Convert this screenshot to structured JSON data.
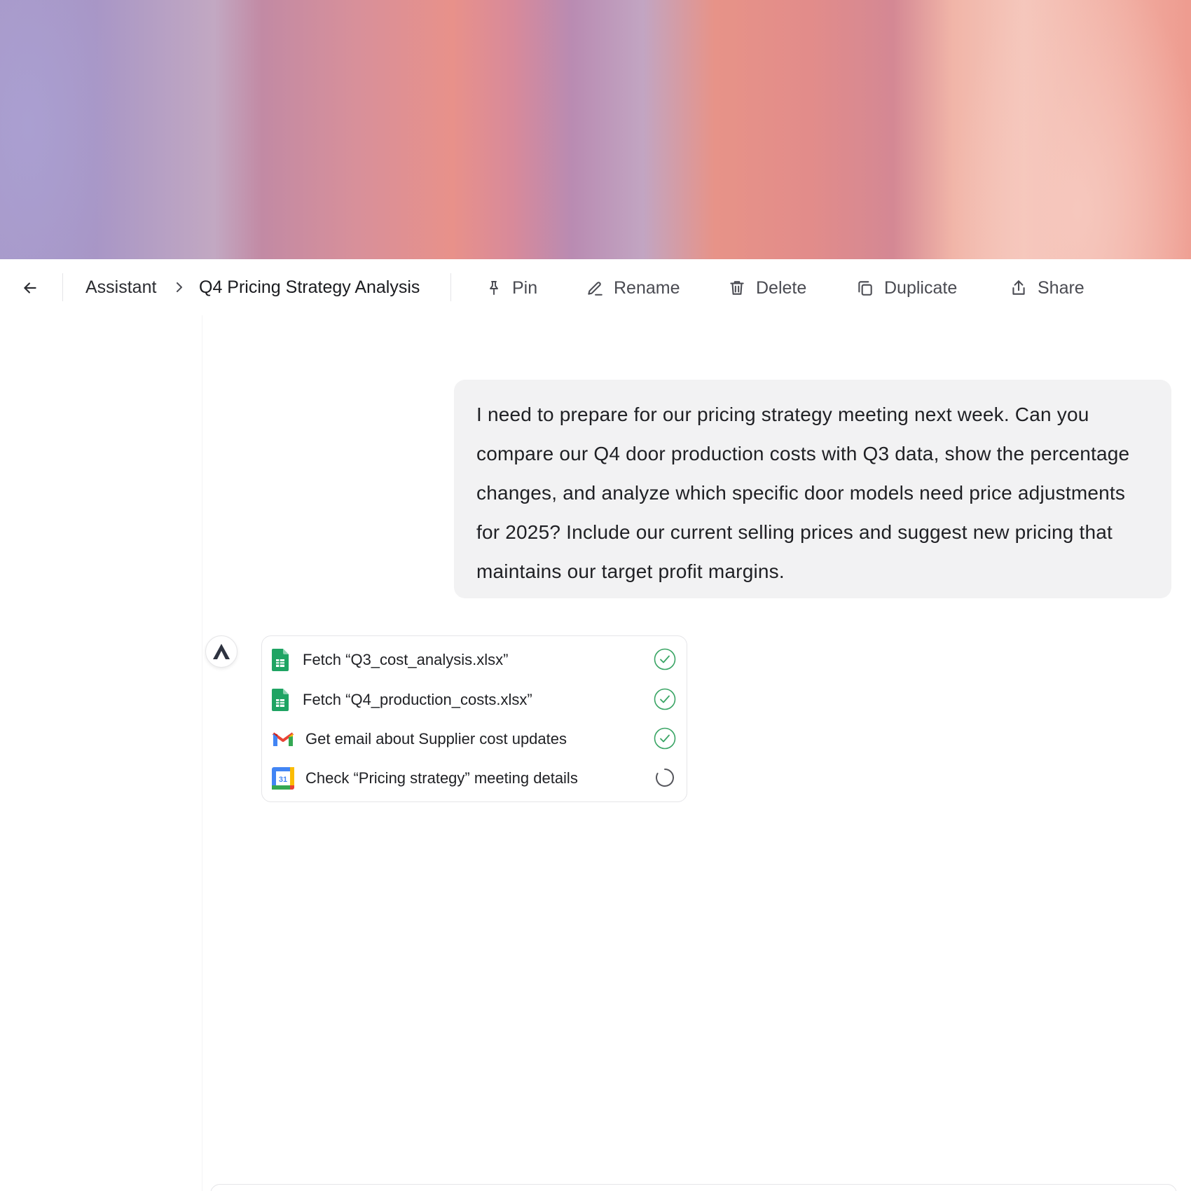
{
  "header": {
    "breadcrumb_parent": "Assistant",
    "breadcrumb_current": "Q4 Pricing Strategy Analysis"
  },
  "actions": {
    "pin": "Pin",
    "rename": "Rename",
    "delete": "Delete",
    "duplicate": "Duplicate",
    "share": "Share"
  },
  "conversation": {
    "user_message": "I need to prepare for our pricing strategy meeting next week. Can you compare our Q4 door production costs with Q3 data, show the percentage changes, and analyze which specific door models need price adjustments for 2025? Include our current selling prices and suggest new pricing that maintains our target profit margins.",
    "tasks": [
      {
        "label": "Fetch “Q3_cost_analysis.xlsx”",
        "icon": "google-sheets-icon",
        "status": "complete"
      },
      {
        "label": "Fetch “Q4_production_costs.xlsx”",
        "icon": "google-sheets-icon",
        "status": "complete"
      },
      {
        "label": "Get email about Supplier cost updates",
        "icon": "gmail-icon",
        "status": "complete"
      },
      {
        "label": "Check “Pricing strategy” meeting details",
        "icon": "google-calendar-icon",
        "status": "in-progress"
      }
    ],
    "calendar_icon_day": "31"
  },
  "colors": {
    "check_green": "#3aa565",
    "sheets_green": "#1fa463",
    "user_bubble": "#f2f2f3"
  }
}
